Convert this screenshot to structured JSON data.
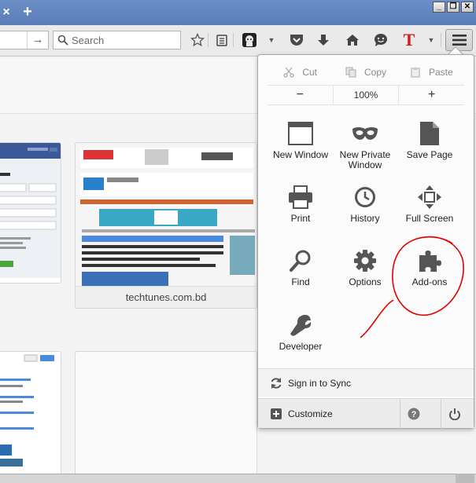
{
  "tabstrip": {
    "close_glyph": "×",
    "new_tab_glyph": "+",
    "window_buttons": [
      "_",
      "❐",
      "✕"
    ]
  },
  "navbar": {
    "go_glyph": "→",
    "search_placeholder": "Search",
    "toolbar_icons": [
      "bookmark-star-icon",
      "reading-list-icon",
      "avatar-icon",
      "pocket-icon",
      "download-icon",
      "home-icon",
      "chat-icon",
      "text-tool-icon"
    ],
    "text_tool_glyph": "T"
  },
  "content": {
    "thumbnails": [
      {
        "caption": "techtunes.com.bd"
      }
    ]
  },
  "menu": {
    "edit": {
      "cut": "Cut",
      "copy": "Copy",
      "paste": "Paste"
    },
    "zoom": {
      "out": "−",
      "level": "100%",
      "in": "+"
    },
    "items": [
      {
        "label": "New Window",
        "icon": "window-icon"
      },
      {
        "label": "New Private Window",
        "icon": "mask-icon"
      },
      {
        "label": "Save Page",
        "icon": "page-icon"
      },
      {
        "label": "Print",
        "icon": "printer-icon"
      },
      {
        "label": "History",
        "icon": "clock-icon"
      },
      {
        "label": "Full Screen",
        "icon": "fullscreen-icon"
      },
      {
        "label": "Find",
        "icon": "magnifier-icon"
      },
      {
        "label": "Options",
        "icon": "gear-icon"
      },
      {
        "label": "Add-ons",
        "icon": "puzzle-icon"
      },
      {
        "label": "Developer",
        "icon": "wrench-icon"
      }
    ],
    "sync_label": "Sign in to Sync",
    "customize_label": "Customize",
    "help_glyph": "?",
    "accent_color": "#e00000"
  }
}
